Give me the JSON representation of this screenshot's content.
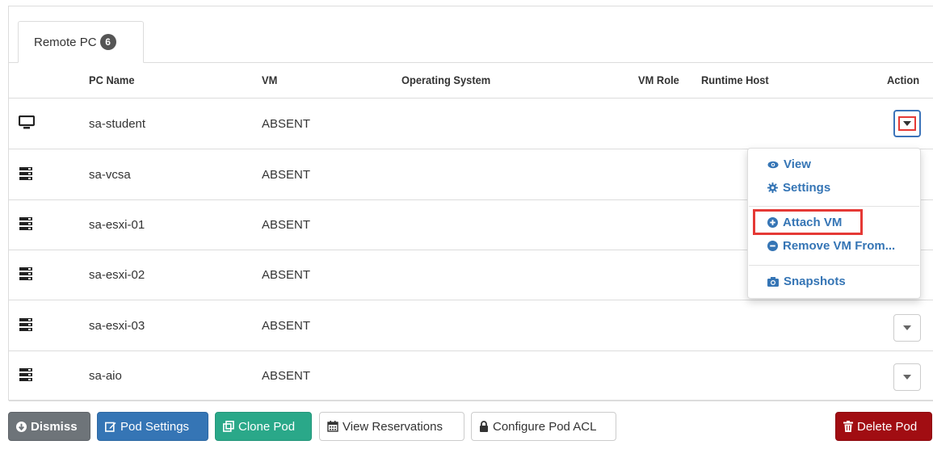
{
  "tab": {
    "label": "Remote PC",
    "count": "6"
  },
  "columns": {
    "pc_name": "PC Name",
    "vm": "VM",
    "os": "Operating System",
    "vm_role": "VM Role",
    "runtime_host": "Runtime Host",
    "action": "Action"
  },
  "rows": [
    {
      "icon": "monitor-icon",
      "name": "sa-student",
      "vm": "ABSENT"
    },
    {
      "icon": "server-icon",
      "name": "sa-vcsa",
      "vm": "ABSENT"
    },
    {
      "icon": "server-icon",
      "name": "sa-esxi-01",
      "vm": "ABSENT"
    },
    {
      "icon": "server-icon",
      "name": "sa-esxi-02",
      "vm": "ABSENT"
    },
    {
      "icon": "server-icon",
      "name": "sa-esxi-03",
      "vm": "ABSENT"
    },
    {
      "icon": "server-icon",
      "name": "sa-aio",
      "vm": "ABSENT"
    }
  ],
  "dropdown": {
    "view": "View",
    "settings": "Settings",
    "attach_vm": "Attach VM",
    "remove_vm": "Remove VM From...",
    "snapshots": "Snapshots"
  },
  "footer": {
    "dismiss": "Dismiss",
    "pod_settings": "Pod Settings",
    "clone_pod": "Clone Pod",
    "view_reservations": "View Reservations",
    "configure_acl": "Configure Pod ACL",
    "delete_pod": "Delete Pod"
  },
  "colors": {
    "primary": "#3575b5",
    "success": "#2aa889",
    "danger": "#a10d12",
    "default": "#6e7479",
    "highlight": "#e53935"
  }
}
